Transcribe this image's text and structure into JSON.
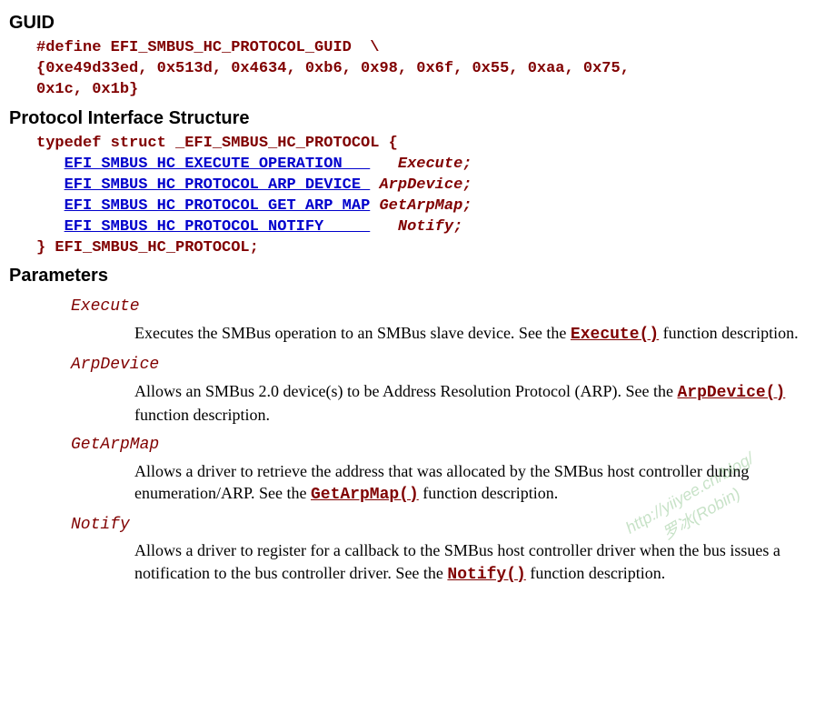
{
  "sections": {
    "guid_heading": "GUID",
    "protocol_heading": "Protocol Interface Structure",
    "parameters_heading": "Parameters"
  },
  "guid_code": {
    "line1": "#define EFI_SMBUS_HC_PROTOCOL_GUID  \\",
    "line2": "{0xe49d33ed, 0x513d, 0x4634, 0xb6, 0x98, 0x6f, 0x55, 0xaa, 0x75,",
    "line3": "0x1c, 0x1b}"
  },
  "protocol_code": {
    "open": "typedef struct _EFI_SMBUS_HC_PROTOCOL {",
    "m1_type": "EFI_SMBUS_HC_EXECUTE_OPERATION   ",
    "m1_pad": "   ",
    "m1_name": "Execute;",
    "m2_type": "EFI_SMBUS_HC_PROTOCOL_ARP_DEVICE ",
    "m2_pad": " ",
    "m2_name": "ArpDevice;",
    "m3_type": "EFI_SMBUS_HC_PROTOCOL_GET_ARP_MAP",
    "m3_pad": " ",
    "m3_name": "GetArpMap;",
    "m4_type": "EFI_SMBUS_HC_PROTOCOL_NOTIFY     ",
    "m4_pad": "   ",
    "m4_name": "Notify;",
    "close": "} EFI_SMBUS_HC_PROTOCOL;"
  },
  "parameters": {
    "execute": {
      "name": "Execute",
      "pre": "Executes the SMBus operation to an SMBus slave device. See the ",
      "link": "Execute()",
      "post": " function description."
    },
    "arpdevice": {
      "name": "ArpDevice",
      "pre": "Allows an SMBus 2.0 device(s) to be Address Resolution Protocol (ARP). See the ",
      "link": "ArpDevice()",
      "post": " function description."
    },
    "getarpmap": {
      "name": "GetArpMap",
      "pre": "Allows a driver to retrieve the address that was allocated by the SMBus host controller during enumeration/ARP. See the ",
      "link": "GetArpMap()",
      "post": " function description."
    },
    "notify": {
      "name": "Notify",
      "pre": "Allows a driver to register for a callback to the SMBus host controller driver when the bus issues a notification to the bus controller driver. See the ",
      "link": "Notify()",
      "post": " function description."
    }
  },
  "watermark": {
    "url": "http://yiiyee.cn/blog/",
    "name": "罗冰(Robin)"
  }
}
